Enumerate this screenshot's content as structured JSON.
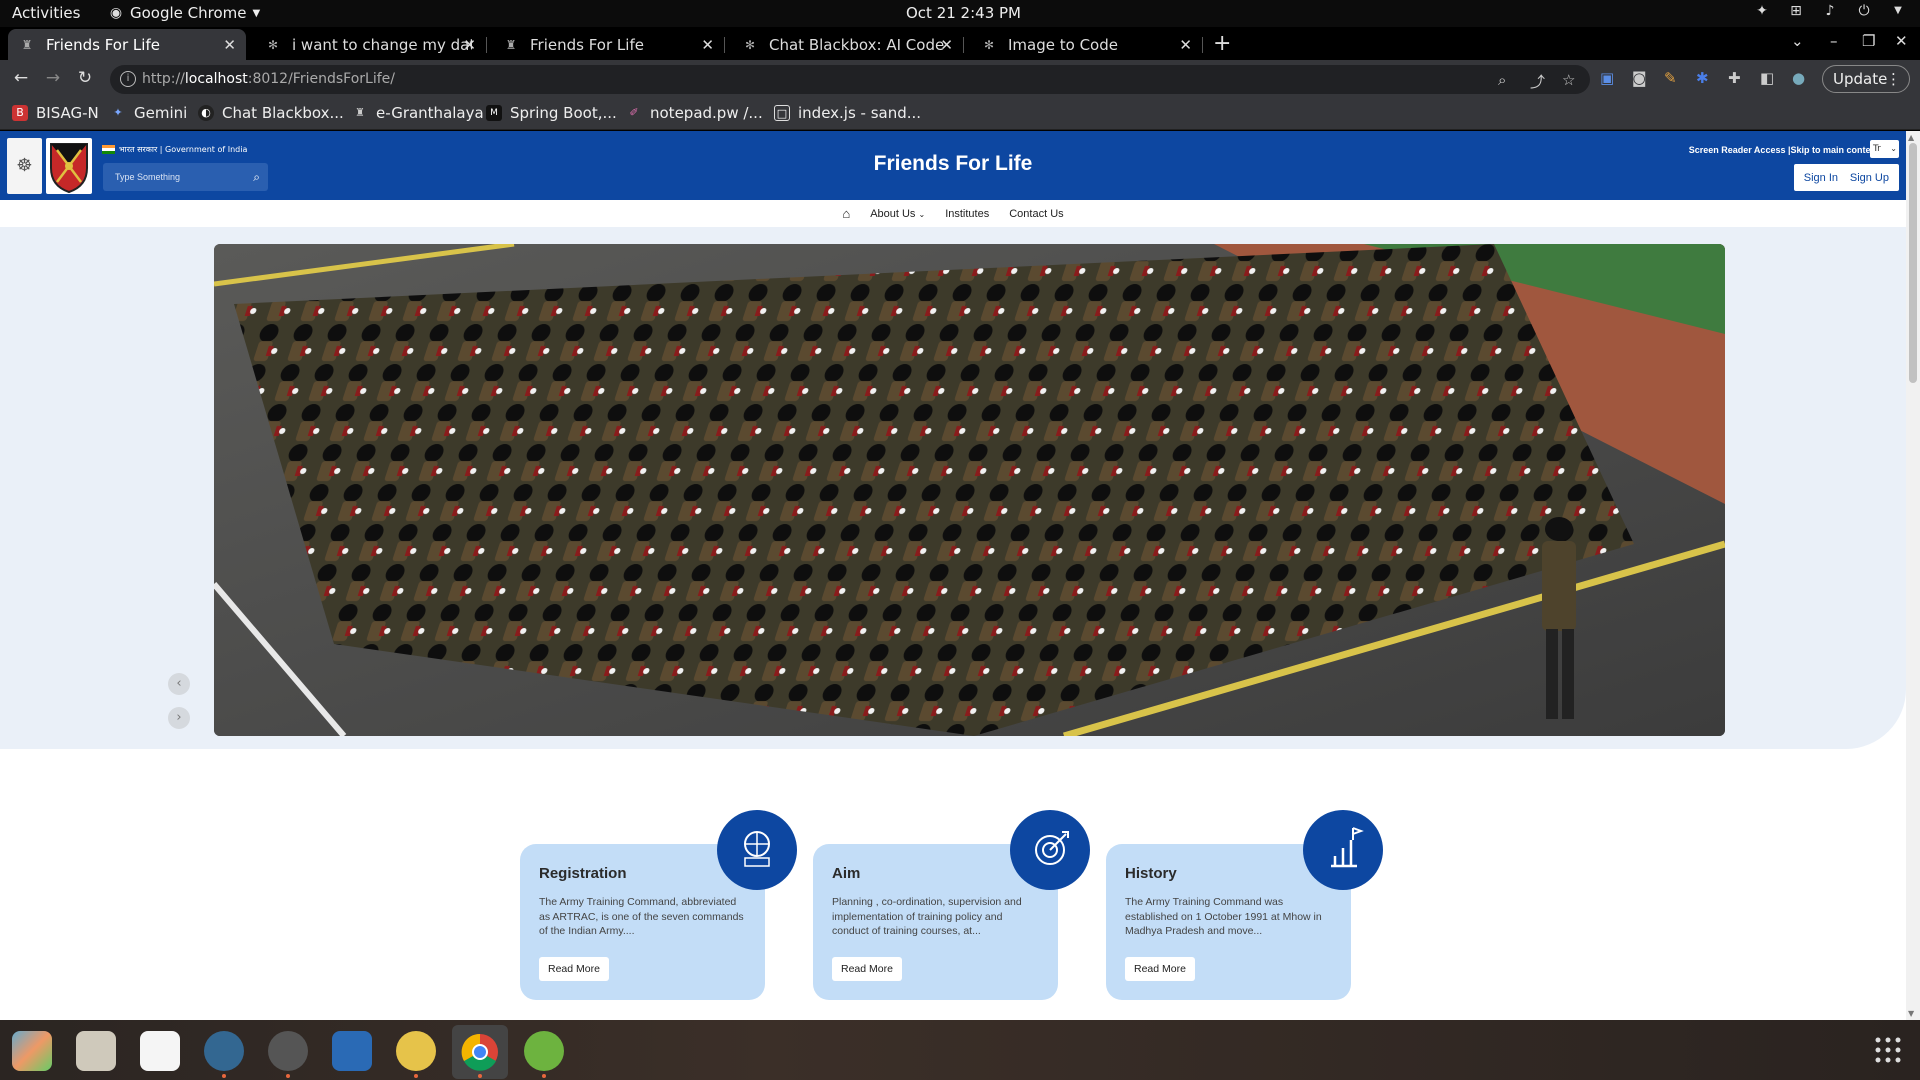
{
  "topbar": {
    "activities": "Activities",
    "app": "Google Chrome",
    "clock": "Oct 21  2:43 PM"
  },
  "tabs": [
    {
      "title": "Friends For Life",
      "active": true
    },
    {
      "title": "i want to change my data",
      "active": false
    },
    {
      "title": "Friends For Life",
      "active": false
    },
    {
      "title": "Chat Blackbox: AI Code Ge",
      "active": false
    },
    {
      "title": "Image to Code",
      "active": false
    }
  ],
  "toolbar": {
    "url_prefix": "http://",
    "url_host": "localhost",
    "url_rest": ":8012/FriendsForLife/",
    "update_label": "Update"
  },
  "bookmarks": [
    "BISAG-N",
    "Gemini",
    "Chat Blackbox...",
    "e-Granthalaya",
    "Spring Boot,...",
    "notepad.pw /...",
    "index.js - sand..."
  ],
  "site": {
    "gov_text": "भारत सरकार | Government of India",
    "search_placeholder": "Type Something",
    "title": "Friends For Life",
    "access_text": "Screen Reader Access |Skip to main content",
    "lang": "Tr",
    "signin": "Sign In",
    "signup": "Sign Up"
  },
  "nav": {
    "about": "About Us",
    "institutes": "Institutes",
    "contact": "Contact Us"
  },
  "cards": [
    {
      "title": "Registration",
      "text": "The Army Training Command, abbreviated as ARTRAC, is one of the seven commands of the Indian Army....",
      "button": "Read More"
    },
    {
      "title": "Aim",
      "text": "Planning , co-ordination, supervision and implementation of training policy and conduct of training courses, at...",
      "button": "Read More"
    },
    {
      "title": "History",
      "text": "The Army Training Command was established on 1 October 1991 at Mhow in Madhya Pradesh and move...",
      "button": "Read More"
    }
  ],
  "colors": {
    "header_blue": "#0d47a1",
    "card_bg": "#c3ddf7",
    "hero_bg": "#eaf0f8"
  }
}
